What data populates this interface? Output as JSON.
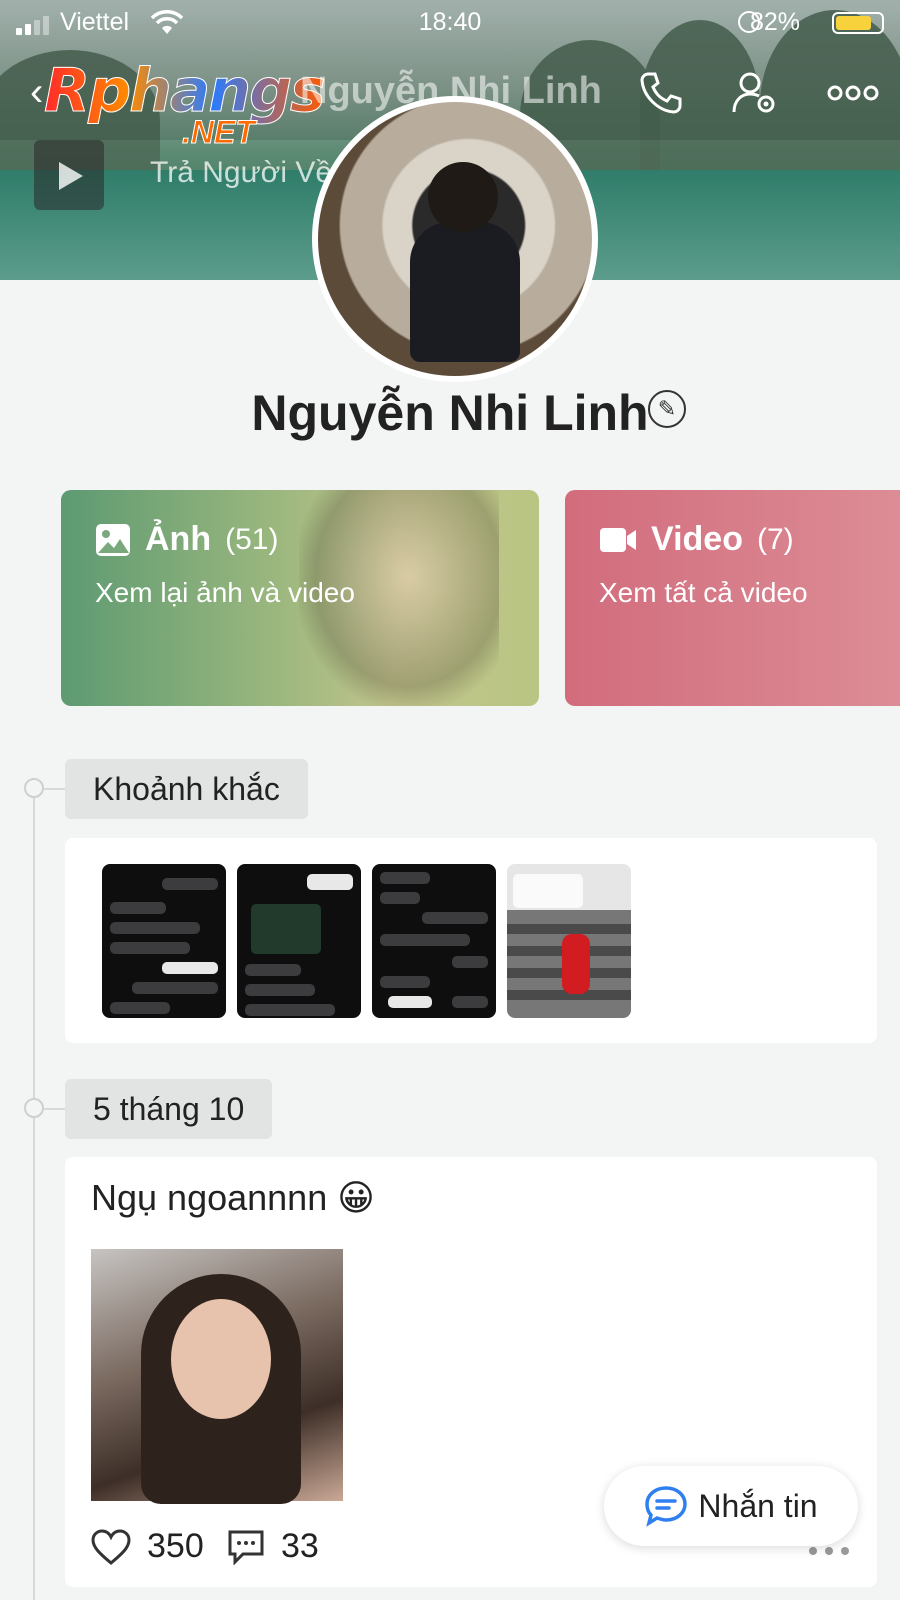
{
  "status": {
    "carrier": "Viettel",
    "time": "18:40",
    "battery": "82%"
  },
  "header": {
    "name": "Nguyễn Nhi Linh",
    "logo_main": "Rphangs",
    "logo_suffix": ".NET"
  },
  "music": {
    "title": "Trả Người Về"
  },
  "profile": {
    "name": "Nguyễn Nhi Linh"
  },
  "cards": [
    {
      "title": "Ảnh",
      "count": "(51)",
      "subtitle": "Xem lại ảnh và video",
      "icon": "image-icon"
    },
    {
      "title": "Video",
      "count": "(7)",
      "subtitle": "Xem tất cả video",
      "icon": "video-camera-icon"
    }
  ],
  "timeline": [
    {
      "label": "Khoảnh khắc"
    },
    {
      "label": "5 tháng 10"
    }
  ],
  "post": {
    "text": "Ngụ ngoannnn",
    "emoji": "😀",
    "likes": "350",
    "comments": "33"
  },
  "fab": {
    "label": "Nhắn tin"
  },
  "colors": {
    "photo_card": "#6fa277",
    "video_card": "#d26c7d",
    "battery": "#f7d23c",
    "message_icon": "#2f7ff0"
  }
}
